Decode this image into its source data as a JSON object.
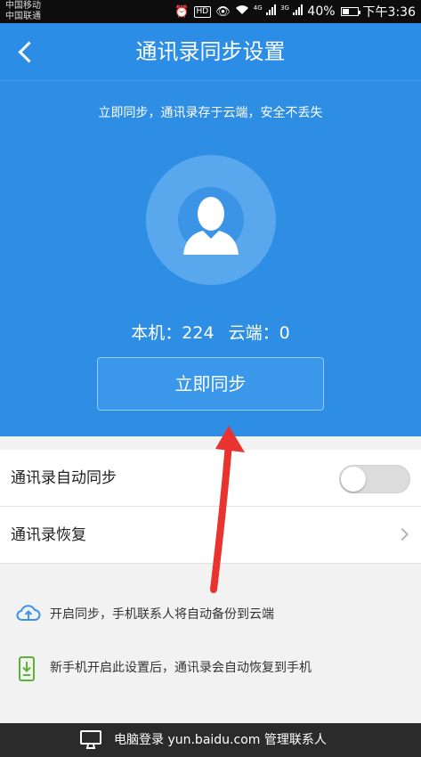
{
  "status_bar": {
    "carrier_1": "中国移动",
    "carrier_2": "中国联通",
    "network_1": "4G",
    "network_2": "3G",
    "battery": "40%",
    "time": "下午3:36"
  },
  "header": {
    "title": "通讯录同步设置"
  },
  "hero": {
    "subtitle": "立即同步，通讯录存于云端，安全不丢失",
    "local_count": "本机：224",
    "cloud_count": "云端：0",
    "sync_button": "立即同步"
  },
  "settings": {
    "auto_sync_label": "通讯录自动同步",
    "auto_sync_enabled": false,
    "restore_label": "通讯录恢复"
  },
  "tips": [
    {
      "icon": "cloud-upload-icon",
      "text": "开启同步，手机联系人将自动备份到云端"
    },
    {
      "icon": "phone-download-icon",
      "text": "新手机开启此设置后，通讯录会自动恢复到手机"
    }
  ],
  "footer": {
    "text": "电脑登录 yun.baidu.com 管理联系人",
    "icon": "computer-icon"
  },
  "colors": {
    "primary": "#2c8de6",
    "annotation_arrow": "#e8332e"
  }
}
